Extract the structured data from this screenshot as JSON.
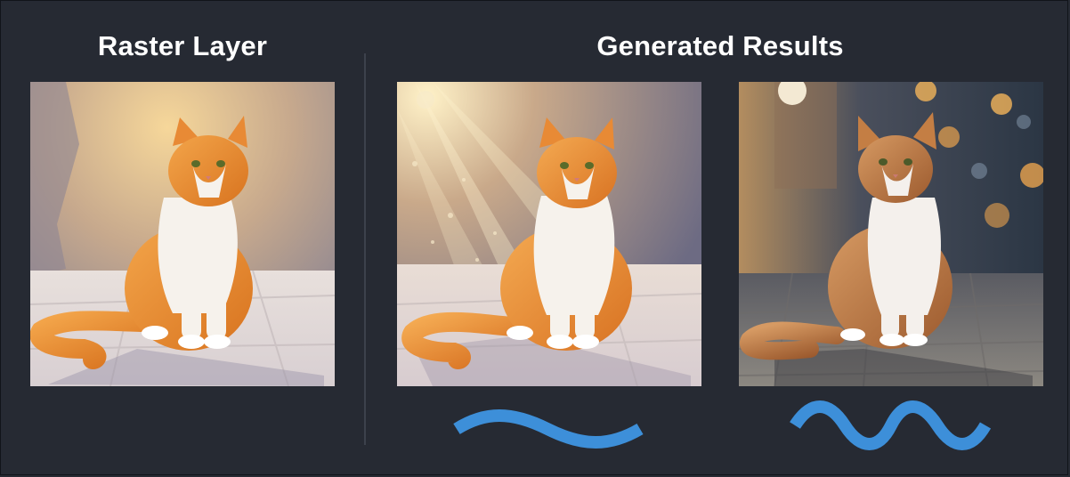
{
  "headings": {
    "left": "Raster Layer",
    "right": "Generated Results"
  },
  "images": [
    {
      "name": "raster-layer-image",
      "depicts": "orange-white-cat-painting"
    },
    {
      "name": "generated-result-1-image",
      "depicts": "orange-white-cat-sunrays"
    },
    {
      "name": "generated-result-2-image",
      "depicts": "orange-white-cat-photo-bokeh"
    }
  ],
  "colors": {
    "background": "#262a33",
    "divider": "#3c414c",
    "heading_text": "#ffffff",
    "wave_accent": "#3d8fd9"
  },
  "icons": {
    "wave_1": "low-frequency-wave-icon",
    "wave_2": "high-frequency-wave-icon"
  }
}
